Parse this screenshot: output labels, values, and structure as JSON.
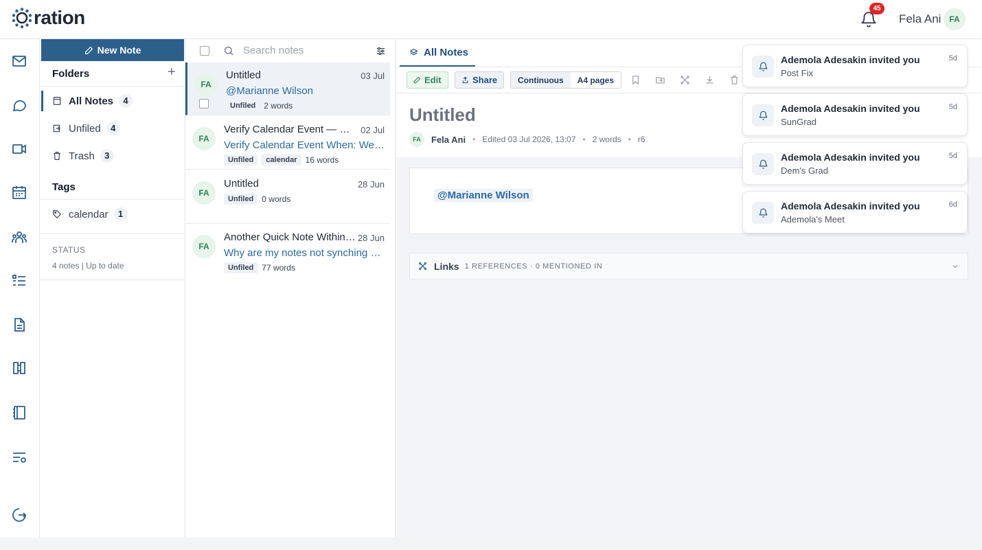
{
  "app": {
    "name": "ration"
  },
  "header": {
    "notification_count": "45",
    "user_name": "Fela Ani",
    "user_initials": "FA"
  },
  "rail": {
    "icons": [
      "mail-icon",
      "chat-icon",
      "video-icon",
      "calendar-icon",
      "people-icon",
      "tasks-icon",
      "document-icon",
      "book-icon",
      "notebook-icon",
      "settings-list-icon",
      "logout-icon"
    ]
  },
  "folders": {
    "new_note_label": "New Note",
    "title": "Folders",
    "add_label": "+",
    "items": [
      {
        "label": "All Notes",
        "count": "4",
        "icon": "notes-icon"
      },
      {
        "label": "Unfiled",
        "count": "4",
        "icon": "unfiled-icon"
      },
      {
        "label": "Trash",
        "count": "3",
        "icon": "trash-icon"
      }
    ],
    "tags_title": "Tags",
    "tags": [
      {
        "label": "calendar",
        "count": "1",
        "icon": "tag-icon"
      }
    ],
    "status_label": "STATUS",
    "status_value": "4 notes | Up to date"
  },
  "notes_list": {
    "search_placeholder": "Search notes",
    "notes": [
      {
        "avatar": "FA",
        "title": "Untitled",
        "date": "03 Jul",
        "preview": "@Marianne Wilson",
        "chips": [
          "Unfiled"
        ],
        "words": "2 words"
      },
      {
        "avatar": "FA",
        "title": "Verify Calendar Event — No…",
        "date": "02 Jul",
        "preview": "Verify Calendar Event When: Wed…",
        "chips": [
          "Unfiled",
          "calendar"
        ],
        "words": "16 words"
      },
      {
        "avatar": "FA",
        "title": "Untitled",
        "date": "28 Jun",
        "preview": "",
        "chips": [
          "Unfiled"
        ],
        "words": "0 words"
      },
      {
        "avatar": "FA",
        "title": "Another Quick Note Within …",
        "date": "28 Jun",
        "preview": "Why are my notes not synching au…",
        "chips": [
          "Unfiled"
        ],
        "words": "77 words"
      }
    ]
  },
  "main": {
    "tab_label": "All Notes",
    "toolbar": {
      "edit": "Edit",
      "share": "Share",
      "continuous": "Continuous",
      "a4": "A4 pages"
    },
    "doc_title": "Untitled",
    "author_initials": "FA",
    "author": "Fela Ani",
    "edited": "Edited 03 Jul 2026, 13:07",
    "words": "2 words",
    "revision": "r6",
    "content_mention": "@Marianne Wilson",
    "links_label": "Links",
    "links_sub": "1 REFERENCES · 0 MENTIONED IN"
  },
  "notifications": [
    {
      "title": "Ademola Adesakin invited you",
      "subtitle": "Post Fix",
      "time": "5d"
    },
    {
      "title": "Ademola Adesakin invited you",
      "subtitle": "SunGrad",
      "time": "5d"
    },
    {
      "title": "Ademola Adesakin invited you",
      "subtitle": "Dem's Grad",
      "time": "5d"
    },
    {
      "title": "Ademola Adesakin invited you",
      "subtitle": "Ademola's Meet",
      "time": "6d"
    }
  ],
  "colors": {
    "primary": "#2d5f8b",
    "link": "#2d6a9f",
    "badge": "#dc2626",
    "avatar_bg": "#e6f4ea",
    "avatar_fg": "#2f855a"
  }
}
